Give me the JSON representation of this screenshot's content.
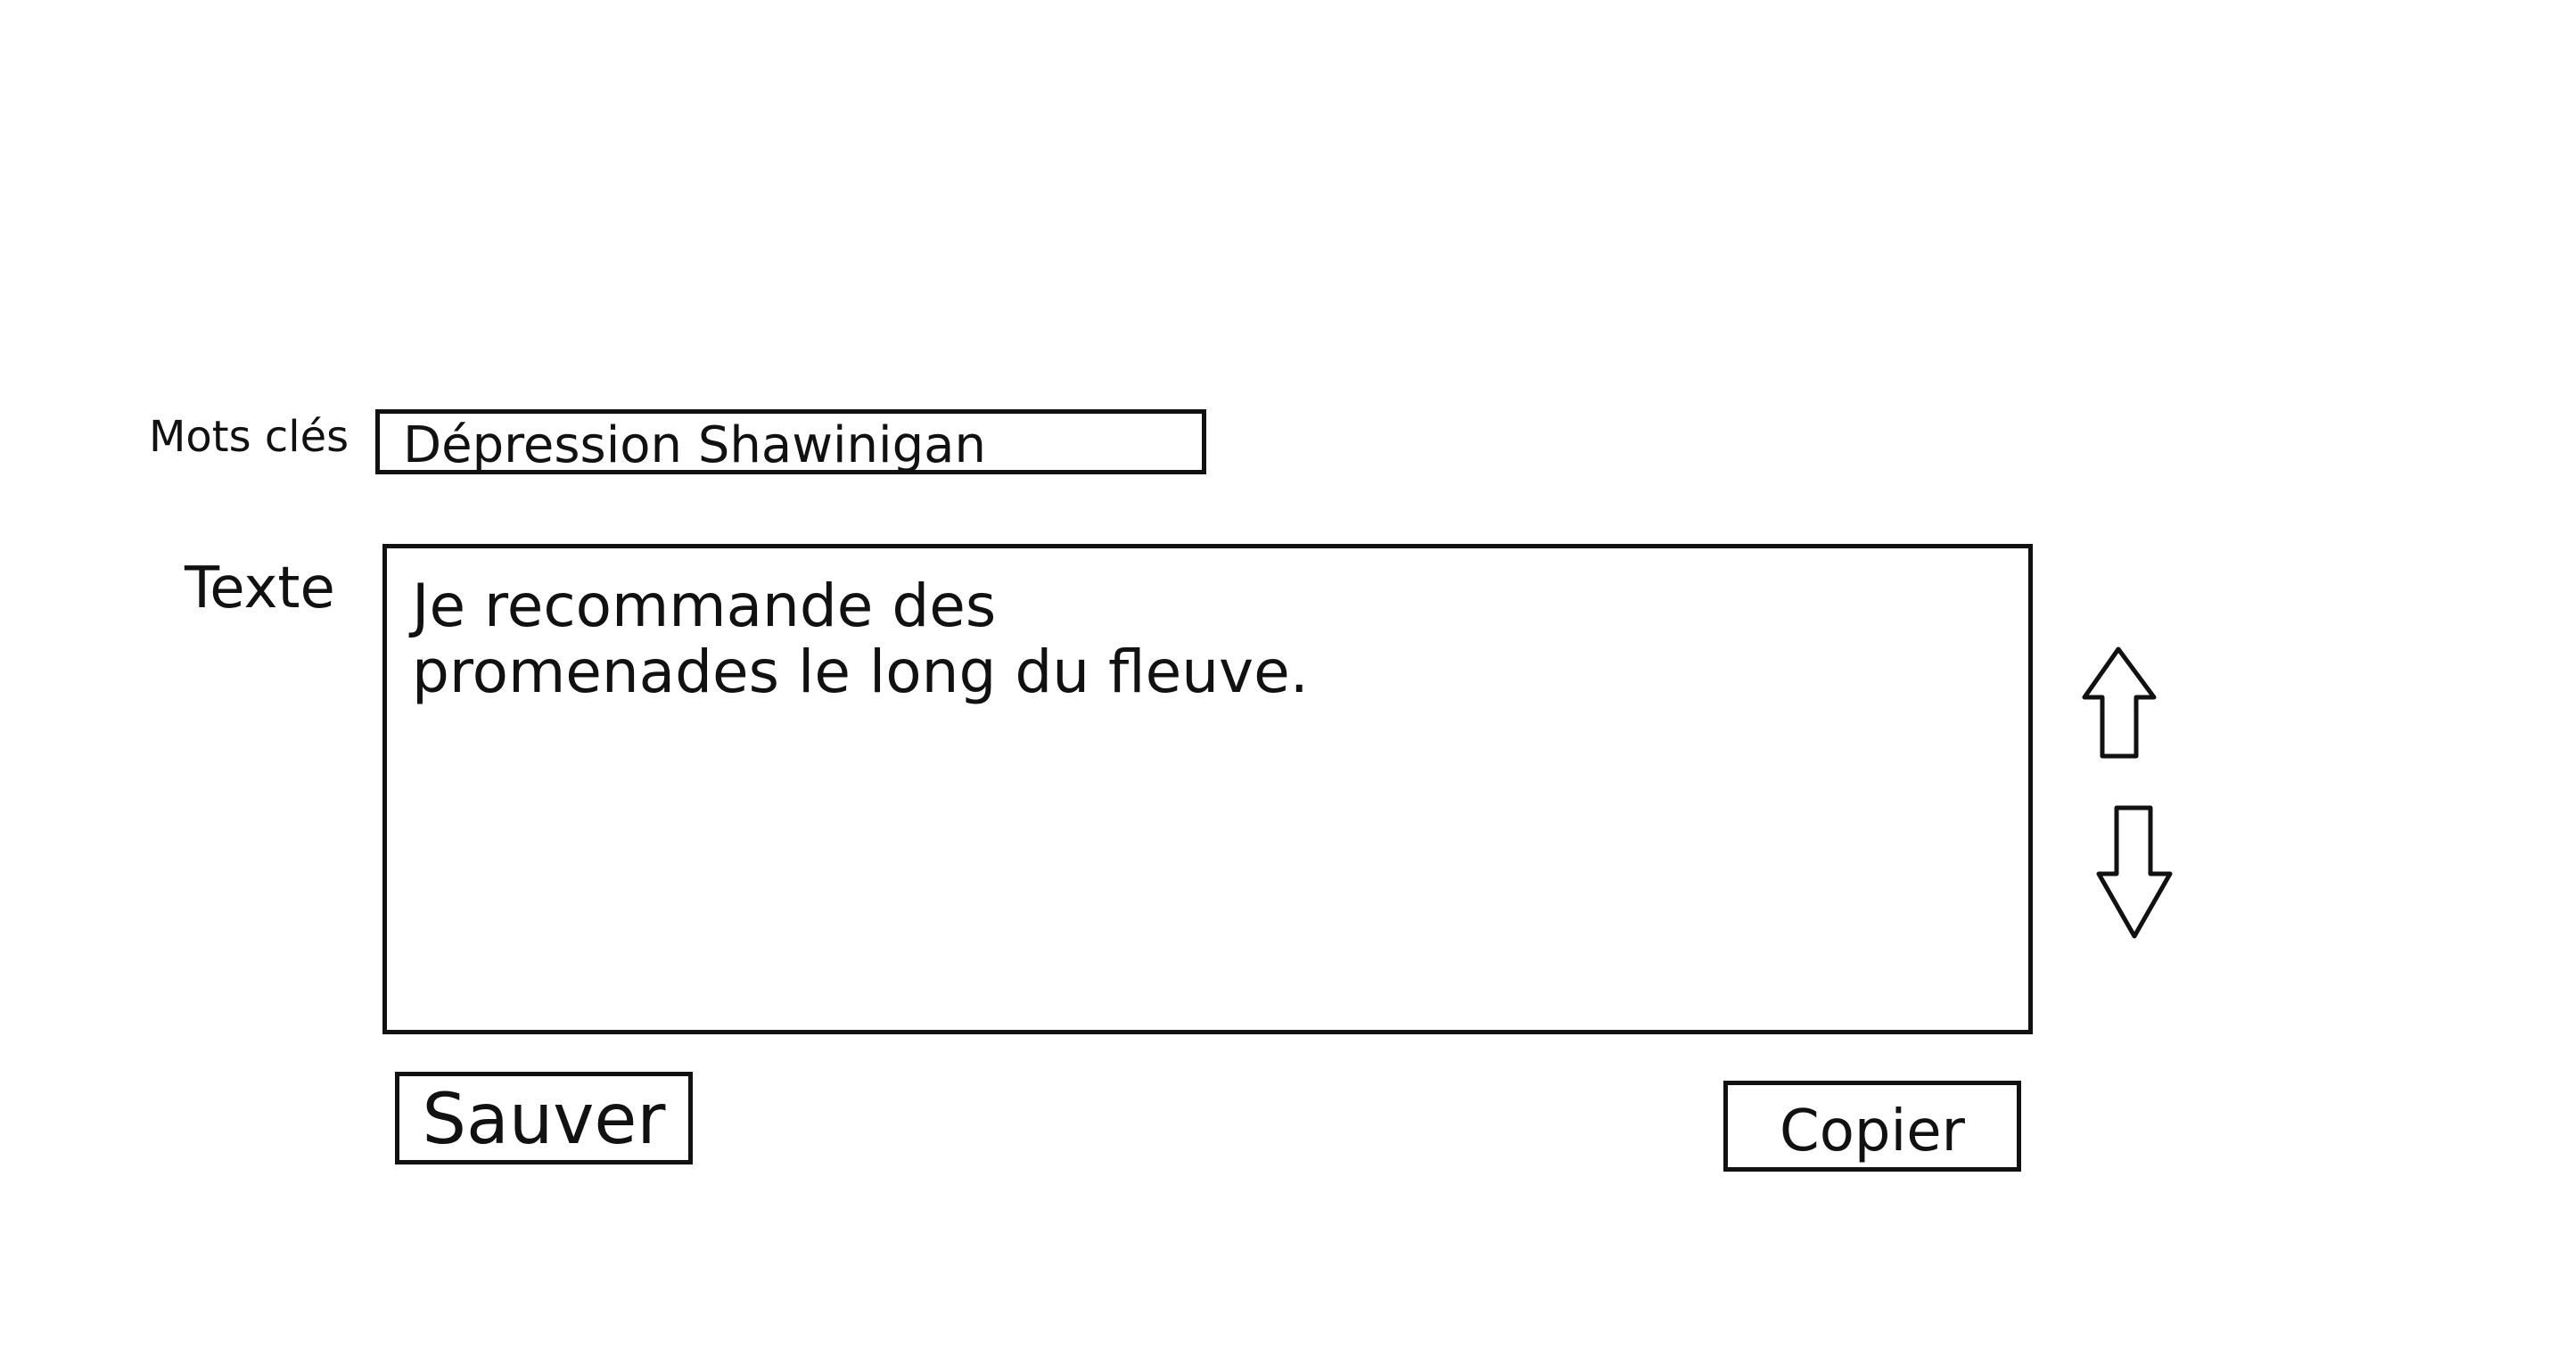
{
  "form": {
    "keywords_label": "Mots clés",
    "keywords_value": "Dépression Shawinigan",
    "text_label": "Texte",
    "text_lines": [
      "Je recommande des",
      "promenades le long du fleuve."
    ]
  },
  "actions": {
    "save_label": "Sauver",
    "copy_label": "Copier"
  },
  "icons": {
    "scroll_up": "arrow-up-icon",
    "scroll_down": "arrow-down-icon"
  },
  "colors": {
    "ink": "#111111",
    "background": "#ffffff"
  }
}
